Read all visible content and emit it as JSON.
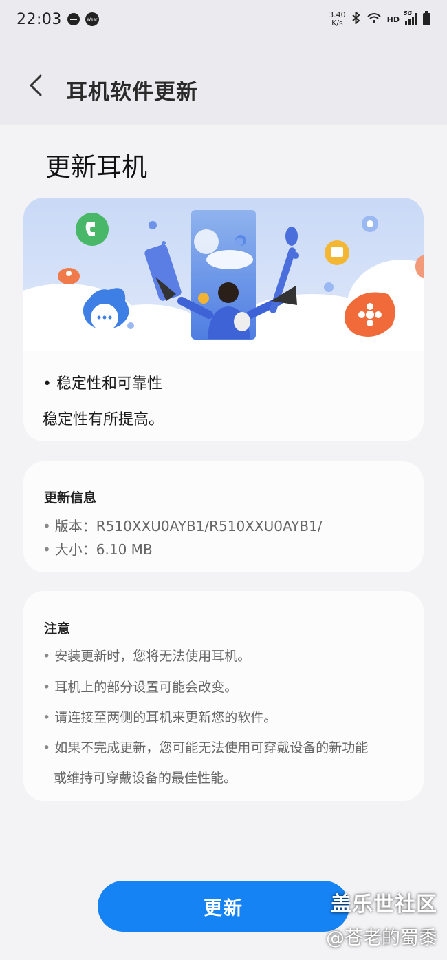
{
  "status_bar": {
    "time": "22:03",
    "wear_label": "Wear",
    "net_speed_value": "3.40",
    "net_speed_unit": "K/s",
    "hd_label": "HD",
    "network_label": "5G"
  },
  "app_bar": {
    "title": "耳机软件更新"
  },
  "page": {
    "heading": "更新耳机"
  },
  "update_card": {
    "bullet_title": "• 稳定性和可靠性",
    "bullet_desc": "稳定性有所提高。"
  },
  "info_card": {
    "label": "更新信息",
    "version_line": "版本：R510XXU0AYB1/R510XXU0AYB1/",
    "size_line": "大小：6.10 MB"
  },
  "note_card": {
    "label": "注意",
    "items": [
      "安装更新时，您将无法使用耳机。",
      "耳机上的部分设置可能会改变。",
      "请连接至两侧的耳机来更新您的软件。",
      "如果不完成更新，您可能无法使用可穿戴设备的新功能"
    ],
    "item_continuation": "或维持可穿戴设备的最佳性能。"
  },
  "action": {
    "update_label": "更新"
  },
  "watermark": {
    "title": "盖乐世社区",
    "handle": "@苍老的蜀黍"
  },
  "colors": {
    "accent": "#1683f4",
    "background": "#f3f3f5",
    "card": "#fcfcfd"
  }
}
